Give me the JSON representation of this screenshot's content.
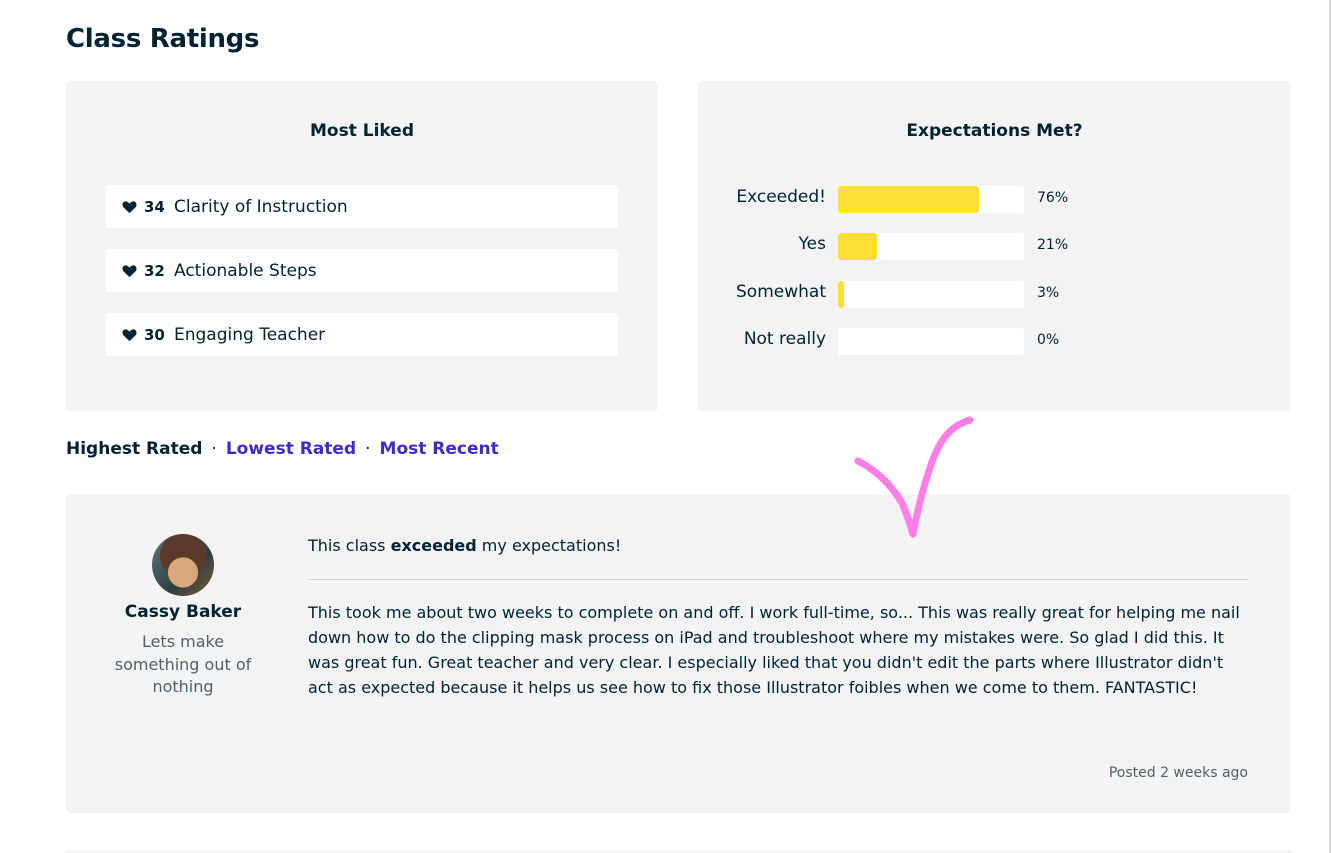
{
  "page": {
    "title": "Class Ratings"
  },
  "most_liked": {
    "title": "Most Liked",
    "items": [
      {
        "count": "34",
        "label": "Clarity of Instruction",
        "icon": "heart-icon"
      },
      {
        "count": "32",
        "label": "Actionable Steps",
        "icon": "heart-icon"
      },
      {
        "count": "30",
        "label": "Engaging Teacher",
        "icon": "heart-icon"
      }
    ]
  },
  "expectations": {
    "title": "Expectations Met?",
    "bar_color": "#ffdf34",
    "items": [
      {
        "label": "Exceeded!",
        "percent": 76,
        "percent_label": "76%"
      },
      {
        "label": "Yes",
        "percent": 21,
        "percent_label": "21%"
      },
      {
        "label": "Somewhat",
        "percent": 3,
        "percent_label": "3%"
      },
      {
        "label": "Not really",
        "percent": 0,
        "percent_label": "0%"
      }
    ]
  },
  "sort": {
    "active": "Highest Rated",
    "options": [
      "Lowest Rated",
      "Most Recent"
    ],
    "separator": "·",
    "link_color": "#3d2cc9"
  },
  "review": {
    "reviewer_name": "Cassy Baker",
    "reviewer_tagline": "Lets make something out of nothing",
    "headline_prefix": "This class ",
    "headline_emphasis": "exceeded",
    "headline_suffix": " my expectations!",
    "body": "This took me about two weeks to complete on and off. I work full-time, so... This was really great for helping me nail down how to do the clipping mask process on iPad and troubleshoot where my mistakes were. So glad I did this. It was great fun. Great teacher and very clear. I especially liked that you didn't edit the parts where Illustrator didn't act as expected because it helps us see how to fix those Illustrator foibles when we come to them. FANTASTIC!",
    "posted": "Posted 2 weeks ago"
  },
  "annotation": {
    "icon": "checkmark-icon",
    "color": "#ff7ee6"
  }
}
